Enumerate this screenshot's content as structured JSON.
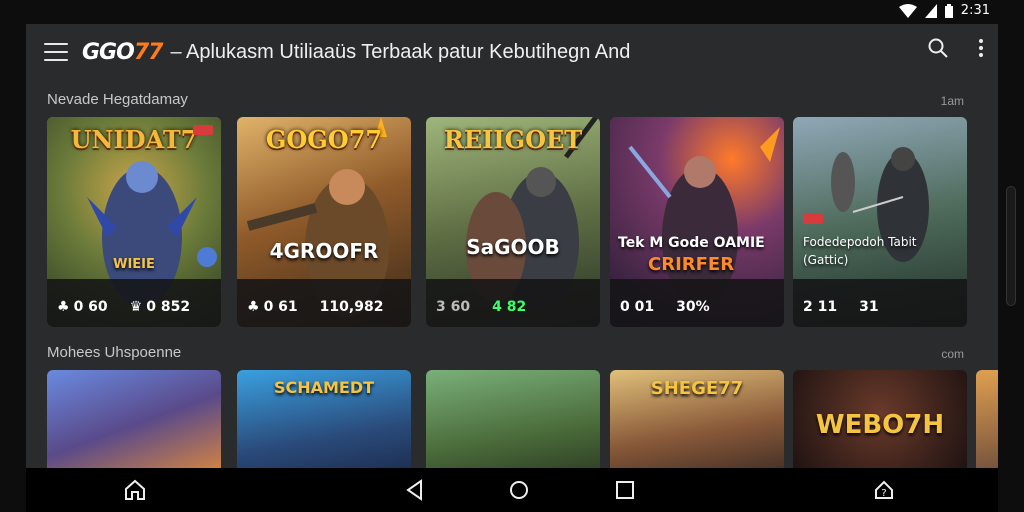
{
  "status": {
    "time": "2:31"
  },
  "appbar": {
    "logo_main": "GGO",
    "logo_accent": "77",
    "title": "– Aplukasm Utiliaaüs Terbaak patur Kebutihegn And"
  },
  "section1": {
    "title": "Nevade Hegatdamay",
    "more": "1am",
    "cards": [
      {
        "title": "UNIDAT7",
        "badge": "WIEIE",
        "stat1": "0 60",
        "stat2": "0 852"
      },
      {
        "title": "GOGO77",
        "badge": "4GROOFR",
        "stat1": "0 61",
        "stat2": "110,982"
      },
      {
        "title": "REIIGOET",
        "badge": "SaGOOB",
        "stat1": "3 60",
        "stat2": "4 82"
      },
      {
        "title": "",
        "badge": "Tek M Gode OAMIE",
        "badge2": "CRIRFER",
        "stat1": "0 01",
        "stat2": "30%"
      },
      {
        "title": "",
        "badge": "Fodedepodoh Tabit",
        "badge2": "(Gattic)",
        "stat1": "2 11",
        "stat2": "31"
      }
    ]
  },
  "section2": {
    "title": "Mohees Uhspoenne",
    "more": "com",
    "cards": [
      {
        "title": ""
      },
      {
        "title": "SCHAMEDT"
      },
      {
        "title": ""
      },
      {
        "title": "SHEGE77"
      },
      {
        "title": "WEBO7H"
      }
    ]
  },
  "colors": {
    "accent": "#ff7a1a",
    "selected": "#e0a72a",
    "background": "#2a2b2d"
  },
  "icons": [
    "menu-icon",
    "search-icon",
    "more-vert-icon",
    "home-icon",
    "back-icon",
    "circle-home-icon",
    "square-recents-icon",
    "support-icon"
  ]
}
